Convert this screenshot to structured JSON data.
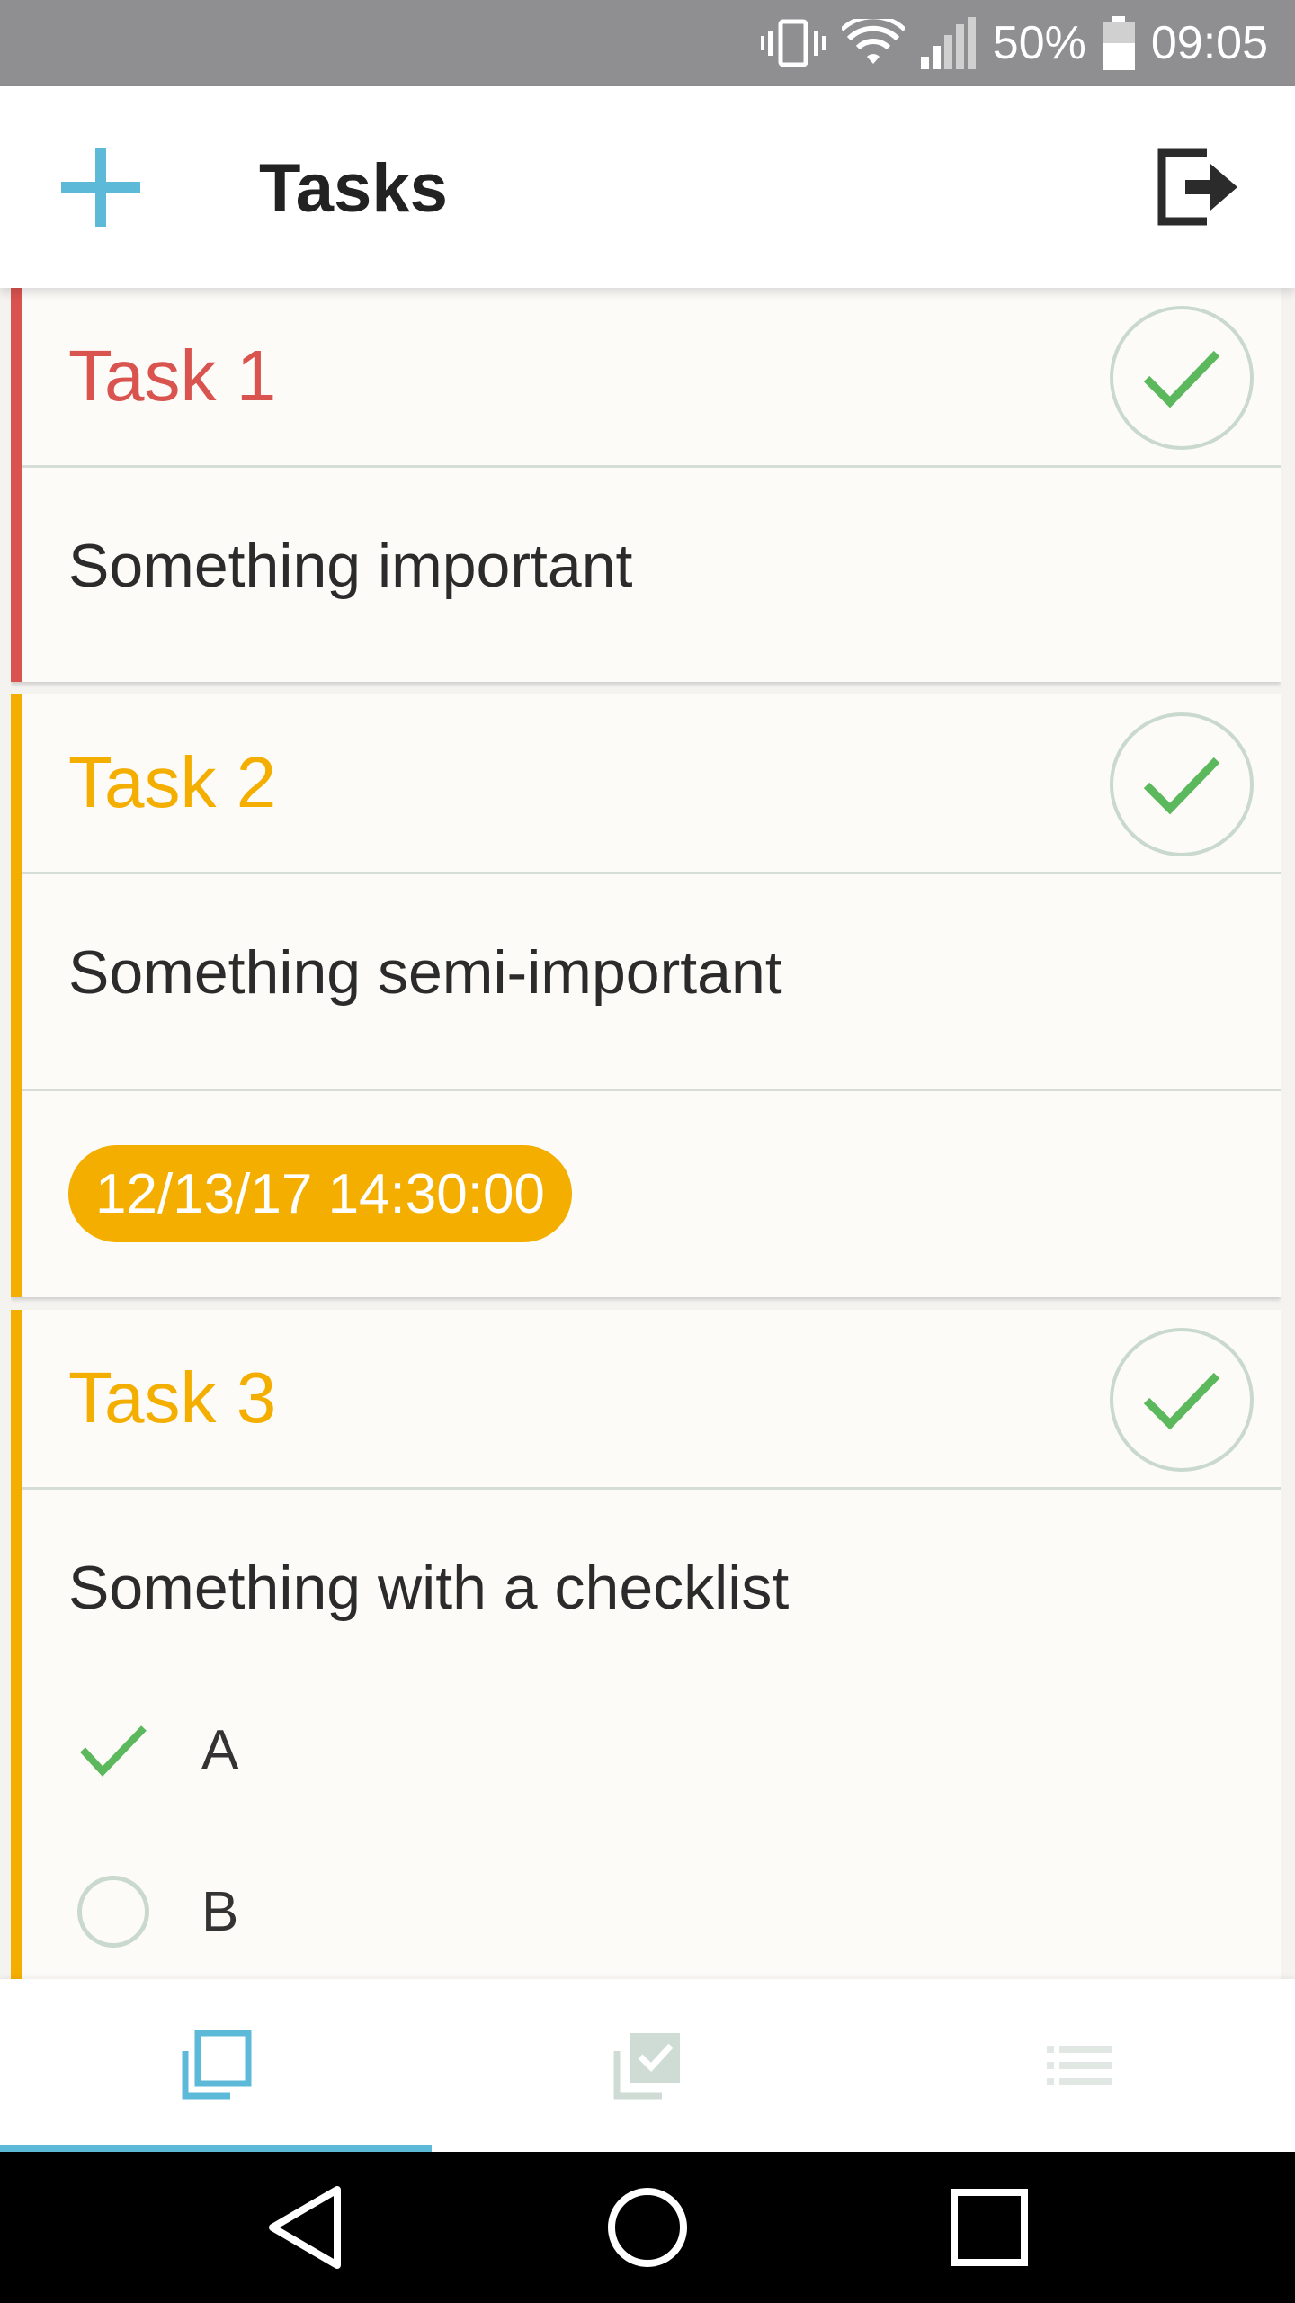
{
  "status_bar": {
    "battery_percent": "50%",
    "time": "09:05",
    "icons": [
      "vibrate-icon",
      "wifi-icon",
      "signal-icon",
      "battery-icon"
    ]
  },
  "app_bar": {
    "title": "Tasks",
    "add_icon": "plus-icon",
    "logout_icon": "logout-icon",
    "accent_color": "#5cbad8"
  },
  "tasks": [
    {
      "title": "Task 1",
      "description": "Something important",
      "priority_color": "#d9534f",
      "done_icon": "check-icon"
    },
    {
      "title": "Task 2",
      "description": "Something semi-important",
      "priority_color": "#f4ae00",
      "due": "12/13/17 14:30:00",
      "done_icon": "check-icon"
    },
    {
      "title": "Task 3",
      "description": "Something with a checklist",
      "priority_color": "#f4ae00",
      "done_icon": "check-icon",
      "checklist": [
        {
          "label": "A",
          "checked": true
        },
        {
          "label": "B",
          "checked": false
        }
      ]
    }
  ],
  "tabs": [
    {
      "icon": "cards-icon",
      "active": true
    },
    {
      "icon": "checked-cards-icon",
      "active": false
    },
    {
      "icon": "list-icon",
      "active": false
    }
  ],
  "nav_bar": {
    "buttons": [
      "back-icon",
      "home-icon",
      "recents-icon"
    ]
  }
}
